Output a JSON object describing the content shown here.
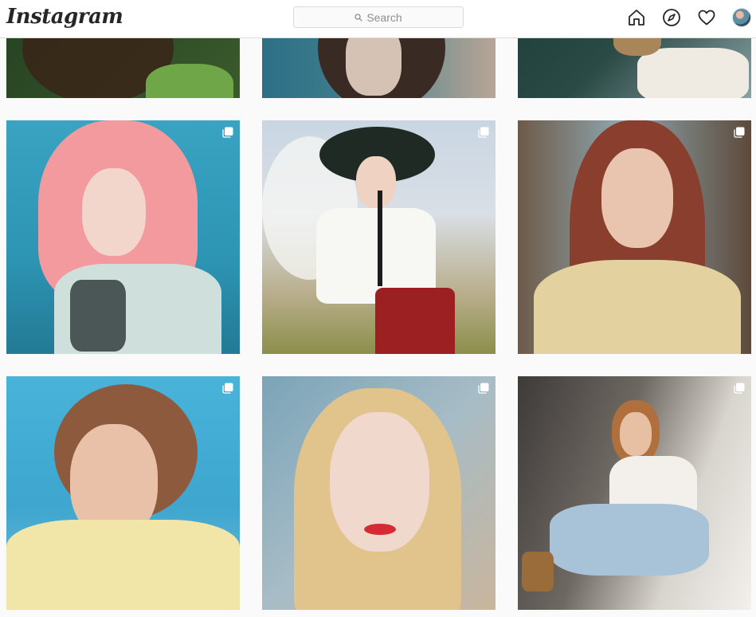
{
  "header": {
    "logo_text": "Instagram",
    "search_placeholder": "Search"
  },
  "nav": [
    {
      "name": "home-icon"
    },
    {
      "name": "explore-icon"
    },
    {
      "name": "heart-icon"
    },
    {
      "name": "avatar"
    }
  ],
  "posts": [
    {
      "id": "post-1",
      "row": 0,
      "col": 0,
      "multi": false,
      "palette": [
        "#1e3a1e",
        "#3b5a2c",
        "#6fa647"
      ]
    },
    {
      "id": "post-2",
      "row": 0,
      "col": 1,
      "multi": false,
      "palette": [
        "#2d6f86",
        "#5c4a40",
        "#d6c2b4"
      ]
    },
    {
      "id": "post-3",
      "row": 0,
      "col": 2,
      "multi": false,
      "palette": [
        "#173531",
        "#8aa0a3",
        "#f0ebe2"
      ]
    },
    {
      "id": "post-4",
      "row": 1,
      "col": 0,
      "multi": true,
      "palette": [
        "#2d94b4",
        "#f29a9e",
        "#cfe0dc"
      ]
    },
    {
      "id": "post-5",
      "row": 1,
      "col": 1,
      "multi": true,
      "palette": [
        "#d9dfe6",
        "#9c1f22",
        "#f7f7f4"
      ]
    },
    {
      "id": "post-6",
      "row": 1,
      "col": 2,
      "multi": true,
      "palette": [
        "#5d4a3b",
        "#8a3e2d",
        "#e3d2a0"
      ]
    },
    {
      "id": "post-7",
      "row": 2,
      "col": 0,
      "multi": true,
      "palette": [
        "#3ea6cf",
        "#8e5a3e",
        "#f1e6a8"
      ]
    },
    {
      "id": "post-8",
      "row": 2,
      "col": 1,
      "multi": true,
      "palette": [
        "#7aa4b8",
        "#e0c48c",
        "#d62b34"
      ]
    },
    {
      "id": "post-9",
      "row": 2,
      "col": 2,
      "multi": true,
      "palette": [
        "#3d3a38",
        "#a8c2d8",
        "#f3f0ec"
      ]
    }
  ]
}
